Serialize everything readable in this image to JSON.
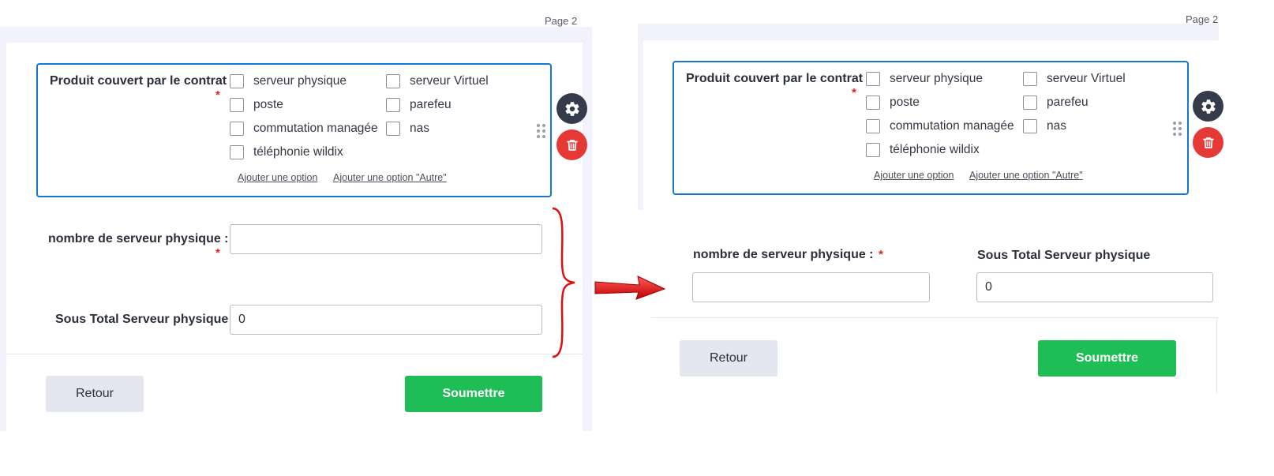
{
  "page_label": "Page 2",
  "question": {
    "label": "Produit couvert par le contrat",
    "required_mark": "*",
    "options": [
      "serveur physique",
      "serveur Virtuel",
      "poste",
      "parefeu",
      "commutation managée",
      "nas",
      "téléphonie wildix"
    ],
    "add_option": "Ajouter une option",
    "add_other_option": "Ajouter une option \"Autre\""
  },
  "field_count": {
    "label": "nombre de serveur physique :",
    "required_mark": "*",
    "value": ""
  },
  "field_subtotal": {
    "label": "Sous Total Serveur physique",
    "value": "0"
  },
  "buttons": {
    "back": "Retour",
    "submit": "Soumettre"
  },
  "icons": {
    "settings": "gear-icon",
    "delete": "trash-icon",
    "drag": "drag-handle-icon",
    "annotation": "red-arrow-icon",
    "brace": "curly-brace-icon"
  },
  "colors": {
    "focus_border": "#1976d2",
    "submit_green": "#1ebd55",
    "delete_red": "#e53935",
    "settings_dark": "#353b4a",
    "annotation_red": "#e01010"
  }
}
